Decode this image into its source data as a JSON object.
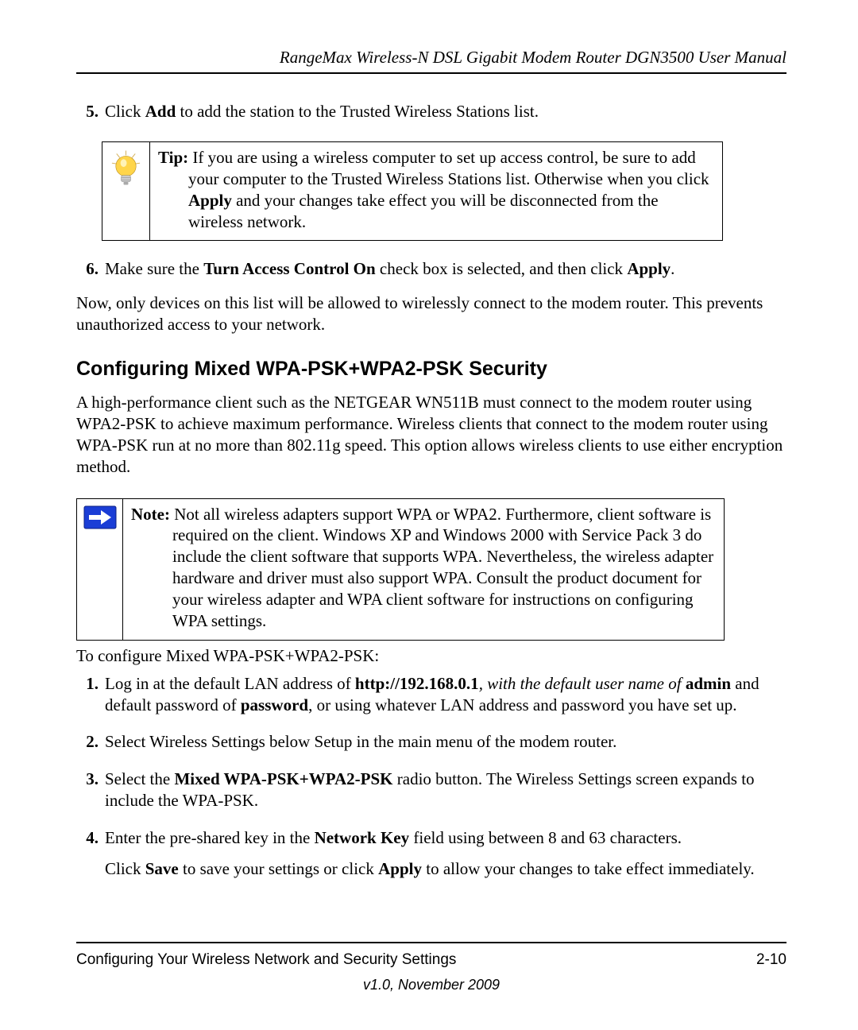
{
  "header": {
    "title": "RangeMax Wireless-N DSL Gigabit Modem Router DGN3500 User Manual"
  },
  "step5": {
    "number": "5.",
    "text_pre": "Click ",
    "bold1": "Add",
    "text_post": " to add the station to the Trusted Wireless Stations list."
  },
  "tip": {
    "label": "Tip:",
    "line1": " If you are using a wireless computer to set up access control, be sure to add your computer to the Trusted Wireless Stations list. Otherwise when you click ",
    "apply": "Apply",
    "line2": " and your changes take effect you will be disconnected from the wireless network."
  },
  "step6": {
    "number": "6.",
    "text_pre": "Make sure the ",
    "bold1": "Turn Access Control On",
    "text_mid": " check box is selected, and then click ",
    "bold2": "Apply",
    "text_post": "."
  },
  "after_step6": "Now, only devices on this list will be allowed to wirelessly connect to the modem router. This prevents unauthorized access to your network.",
  "heading": "Configuring Mixed WPA-PSK+WPA2-PSK Security",
  "section_intro": "A high-performance client such as the NETGEAR WN511B must connect to the modem router using WPA2-PSK to achieve maximum performance. Wireless clients that connect to the modem router using WPA-PSK run at no more than 802.11g speed. This option allows wireless clients to use either encryption method.",
  "note": {
    "label": "Note:",
    "body": " Not all wireless adapters support WPA or WPA2. Furthermore, client software is required on the client. Windows XP and Windows 2000 with Service Pack 3 do include the client software that supports WPA. Nevertheless, the wireless adapter hardware and driver must also support WPA. Consult the product document for your wireless adapter and WPA client software for instructions on configuring WPA settings."
  },
  "configure_intro": "To configure Mixed WPA-PSK+WPA2-PSK:",
  "steps": {
    "s1": {
      "num": "1.",
      "t0": "Log in at the default LAN address of ",
      "b0": "http://192.168.0.1",
      "t1": ", with the default user name of ",
      "b1": "admin",
      "t2": " and default password of ",
      "b2": "password",
      "t3": ", or using whatever LAN address and password you have set up."
    },
    "s2": {
      "num": "2.",
      "t0": "Select Wireless Settings below Setup in the main menu of the modem router."
    },
    "s3": {
      "num": "3.",
      "t0": "Select the ",
      "b0": "Mixed WPA-PSK+WPA2-PSK",
      "t1": " radio button. The Wireless Settings screen expands to include the WPA-PSK."
    },
    "s4": {
      "num": "4.",
      "t0": "Enter the pre-shared key in the ",
      "b0": "Network Key",
      "t1": " field using between 8 and 63 characters.",
      "p2_t0": "Click ",
      "p2_b0": "Save",
      "p2_t1": " to save your settings or click ",
      "p2_b1": "Apply",
      "p2_t2": " to allow your changes to take effect immediately."
    }
  },
  "footer": {
    "section": "Configuring Your Wireless Network and Security Settings",
    "page": "2-10",
    "version": "v1.0, November 2009"
  },
  "icons": {
    "tip": "lightbulb-icon",
    "note": "arrow-icon"
  }
}
